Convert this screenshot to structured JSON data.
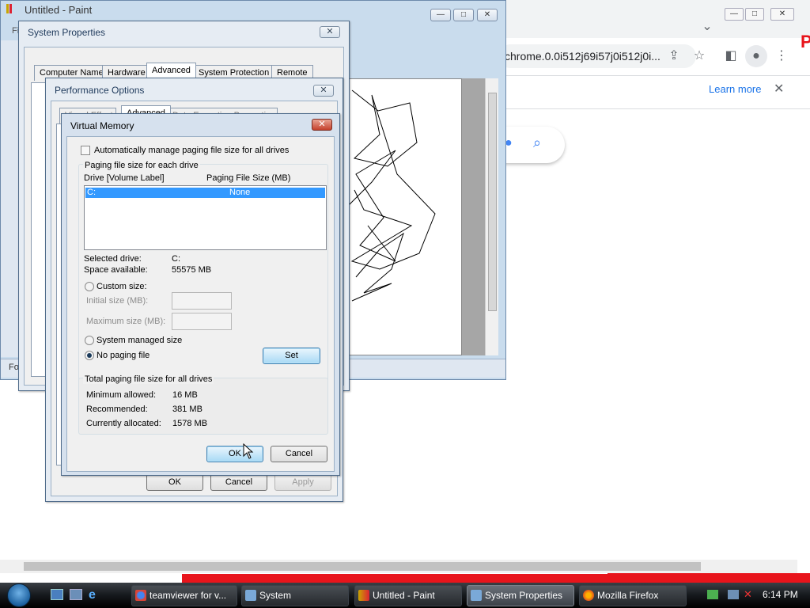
{
  "chrome": {
    "address": "chrome.0.0i512j69i57j0i512j0i...",
    "learn_more": "Learn more",
    "close_x": "✕",
    "partial_logo_text": "P"
  },
  "paint": {
    "title": "Untitled - Paint",
    "menu_partial": "Fi",
    "status_partial": "Fo"
  },
  "system_properties": {
    "title": "System Properties",
    "tabs": [
      "Computer Name",
      "Hardware",
      "Advanced",
      "System Protection",
      "Remote"
    ],
    "selected_tab": "Advanced"
  },
  "performance_options": {
    "title": "Performance Options",
    "tabs": [
      "Visual Effects",
      "Advanced",
      "Data Execution Prevention"
    ],
    "buttons": {
      "ok": "OK",
      "cancel": "Cancel",
      "apply": "Apply"
    }
  },
  "virtual_memory": {
    "title": "Virtual Memory",
    "auto_manage_label": "Automatically manage paging file size for all drives",
    "auto_manage_checked": false,
    "group_each_drive": "Paging file size for each drive",
    "col_drive": "Drive  [Volume Label]",
    "col_size": "Paging File Size (MB)",
    "drives": [
      {
        "drive": "C:",
        "size": "None",
        "selected": true
      }
    ],
    "selected_drive_label": "Selected drive:",
    "selected_drive_value": "C:",
    "space_available_label": "Space available:",
    "space_available_value": "55575 MB",
    "custom_size_label": "Custom size:",
    "initial_size_label": "Initial size (MB):",
    "maximum_size_label": "Maximum size (MB):",
    "system_managed_label": "System managed size",
    "no_paging_label": "No paging file",
    "selected_option": "No paging file",
    "set_button": "Set",
    "group_total": "Total paging file size for all drives",
    "min_allowed_label": "Minimum allowed:",
    "min_allowed_value": "16 MB",
    "recommended_label": "Recommended:",
    "recommended_value": "381 MB",
    "currently_allocated_label": "Currently allocated:",
    "currently_allocated_value": "1578 MB",
    "ok_button": "OK",
    "cancel_button": "Cancel"
  },
  "taskbar": {
    "items": [
      {
        "label": "teamviewer for v...",
        "icon": "chrome-icon"
      },
      {
        "label": "System",
        "icon": "system-icon"
      },
      {
        "label": "Untitled - Paint",
        "icon": "paint-icon"
      },
      {
        "label": "System Properties",
        "icon": "system-properties-icon",
        "active": true
      },
      {
        "label": "Mozilla Firefox",
        "icon": "firefox-icon"
      }
    ],
    "time": "6:14 PM"
  },
  "colors": {
    "vista_title": "#1e395b",
    "selection_blue": "#3399ff",
    "accent_link": "#1a73e8"
  }
}
